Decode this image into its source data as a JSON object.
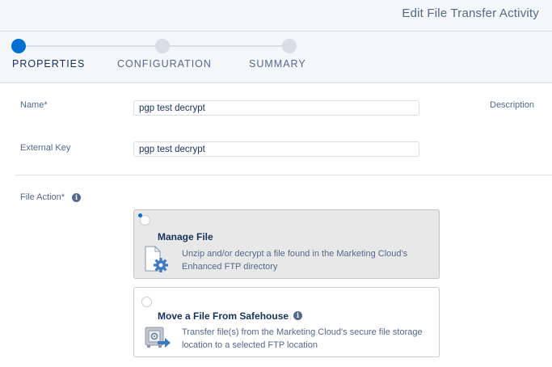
{
  "header": {
    "title": "Edit File Transfer Activity"
  },
  "stepper": {
    "steps": [
      {
        "label": "PROPERTIES",
        "state": "active"
      },
      {
        "label": "CONFIGURATION",
        "state": "incomplete"
      },
      {
        "label": "SUMMARY",
        "state": "incomplete"
      }
    ]
  },
  "form": {
    "name_label": "Name*",
    "name_value": "pgp test decrypt",
    "external_key_label": "External Key",
    "external_key_value": "pgp test decrypt",
    "description_label": "Description",
    "file_action_label": "File Action*",
    "info_icon": "i"
  },
  "options": [
    {
      "title": "Manage File",
      "description": "Unzip and/or decrypt a file found in the Marketing Cloud's Enhanced FTP directory",
      "selected": true,
      "icon": "file-gear-icon"
    },
    {
      "title": "Move a File From Safehouse",
      "description": "Transfer file(s) from the Marketing Cloud's secure file storage location to a selected FTP location",
      "selected": false,
      "icon": "safe-transfer-icon"
    }
  ],
  "colors": {
    "accent": "#0070d2",
    "text_dark": "#16325c",
    "text_muted": "#54698d",
    "header_bg": "#f4f6f9",
    "selected_card_bg": "#e8e8e8"
  }
}
